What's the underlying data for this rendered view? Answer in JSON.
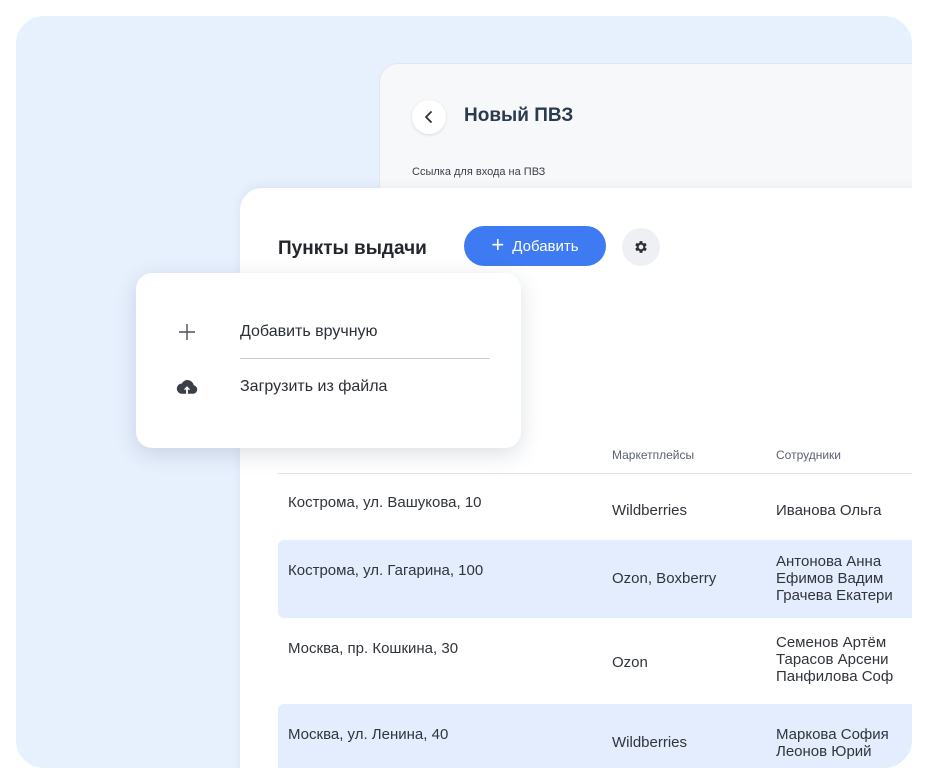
{
  "new_pvz": {
    "title": "Новый ПВЗ",
    "link_label": "Ссылка для входа на ПВЗ"
  },
  "pickup_points": {
    "title": "Пункты выдачи",
    "add_button_label": "Добавить",
    "add_button_icon": "plus-icon",
    "settings_icon": "gear-icon"
  },
  "menu": {
    "items": [
      {
        "label": "Добавить вручную",
        "icon": "plus-icon"
      },
      {
        "label": "Загрузить из файла",
        "icon": "cloud-upload-icon"
      }
    ]
  },
  "table": {
    "headers": {
      "marketplaces": "Маркетплейсы",
      "employees": "Сотрудники"
    },
    "rows": [
      {
        "address": "Кострома, ул. Вашукова, 10",
        "marketplaces": "Wildberries",
        "employees": [
          "Иванова Ольга"
        ]
      },
      {
        "address": "Кострома, ул. Гагарина, 100",
        "marketplaces": "Ozon, Boxberry",
        "employees": [
          "Антонова Анна",
          "Ефимов Вадим",
          "Грачева Екатери"
        ]
      },
      {
        "address": "Москва, пр. Кошкина, 30",
        "marketplaces": "Ozon",
        "employees": [
          "Семенов Артём",
          "Тарасов Арсени",
          "Панфилова Соф"
        ]
      },
      {
        "address": "Москва, ул. Ленина, 40",
        "marketplaces": "Wildberries",
        "employees": [
          "Маркова София",
          "Леонов Юрий"
        ]
      }
    ]
  },
  "colors": {
    "background": "#e7f0fd",
    "accent": "#3e7bf2",
    "row_highlight": "#e3edfd"
  }
}
